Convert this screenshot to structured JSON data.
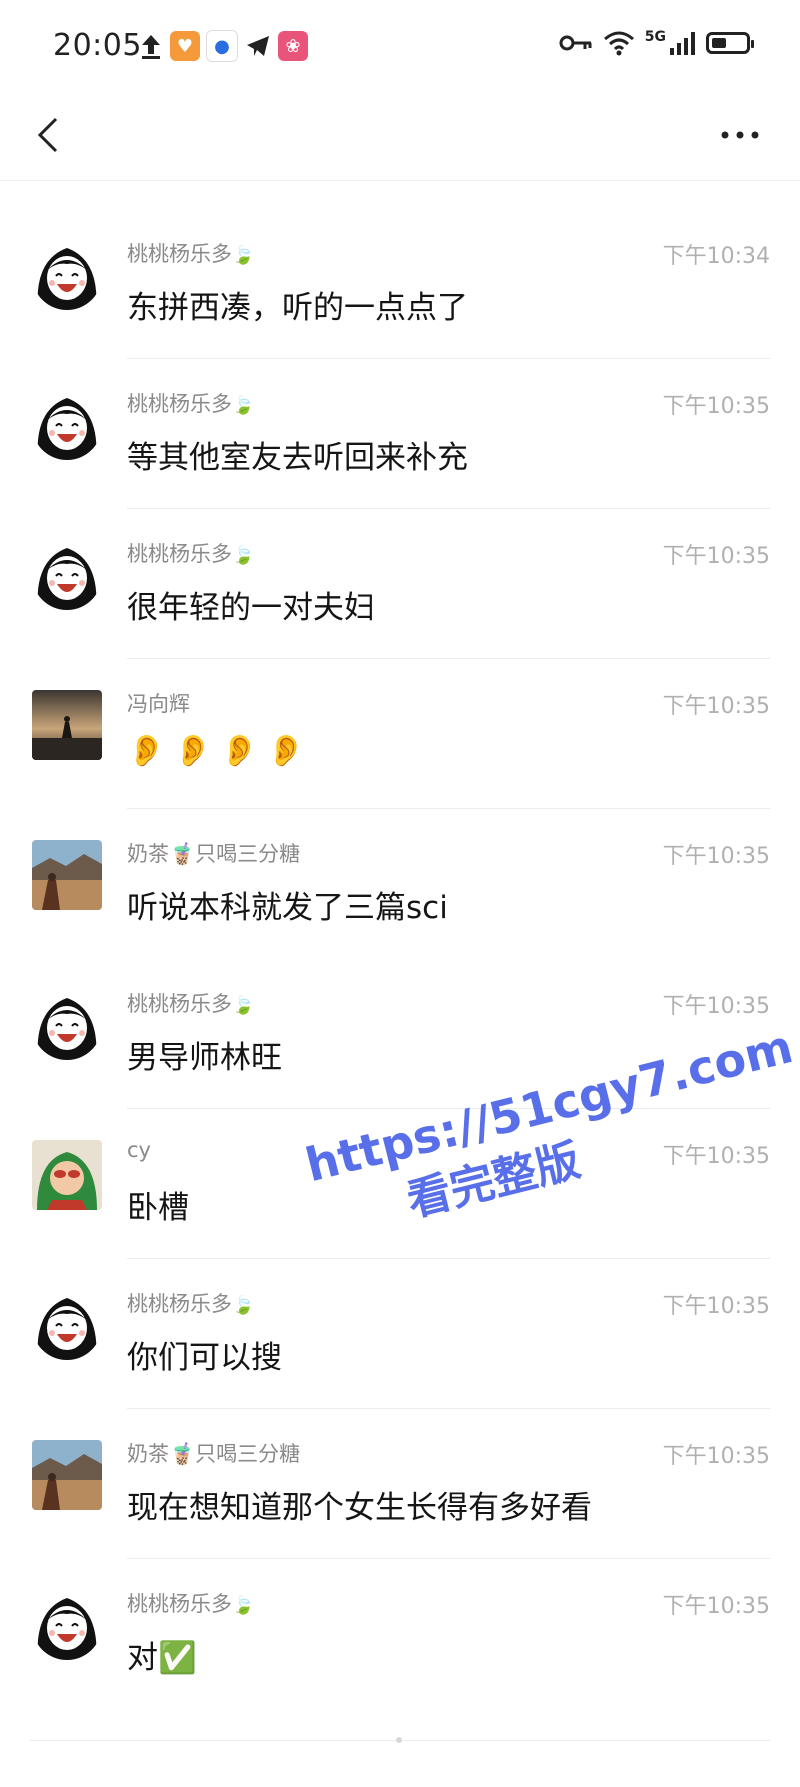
{
  "status_bar": {
    "time": "20:05",
    "network": "5G",
    "icons": [
      "upload-icon",
      "app-icon-orange",
      "app-icon-blue",
      "telegram-icon",
      "app-icon-pink",
      "key-icon",
      "wifi-icon",
      "signal-icon",
      "battery-icon"
    ]
  },
  "nav": {
    "back_icon": "chevron-left-icon",
    "more_icon": "more-horizontal-icon"
  },
  "messages": [
    {
      "sender": "桃桃杨乐多",
      "sender_emoji": "🍃",
      "time": "下午10:34",
      "text": "东拼西凑，听的一点点了",
      "avatar": "girl-cartoon"
    },
    {
      "sender": "桃桃杨乐多",
      "sender_emoji": "🍃",
      "time": "下午10:35",
      "text": "等其他室友去听回来补充",
      "avatar": "girl-cartoon"
    },
    {
      "sender": "桃桃杨乐多",
      "sender_emoji": "🍃",
      "time": "下午10:35",
      "text": "很年轻的一对夫妇",
      "avatar": "girl-cartoon"
    },
    {
      "sender": "冯向辉",
      "sender_emoji": "",
      "time": "下午10:35",
      "text": "👂👂👂👂",
      "avatar": "sunset-photo"
    },
    {
      "sender": "奶茶",
      "sender_emoji": "🧋只喝三分糖",
      "time": "下午10:35",
      "text": "听说本科就发了三篇sci",
      "avatar": "landscape-photo"
    },
    {
      "sender": "桃桃杨乐多",
      "sender_emoji": "🍃",
      "time": "下午10:35",
      "text": "男导师林旺",
      "avatar": "girl-cartoon"
    },
    {
      "sender": "cy",
      "sender_emoji": "",
      "time": "下午10:35",
      "text": "卧槽",
      "avatar": "kid-photo"
    },
    {
      "sender": "桃桃杨乐多",
      "sender_emoji": "🍃",
      "time": "下午10:35",
      "text": "你们可以搜",
      "avatar": "girl-cartoon"
    },
    {
      "sender": "奶茶",
      "sender_emoji": "🧋只喝三分糖",
      "time": "下午10:35",
      "text": "现在想知道那个女生长得有多好看",
      "avatar": "landscape-photo"
    },
    {
      "sender": "桃桃杨乐多",
      "sender_emoji": "🍃",
      "time": "下午10:35",
      "text": "对✅",
      "avatar": "girl-cartoon"
    }
  ],
  "watermark": {
    "url": "https://51cgy7.com",
    "subtitle": "看完整版"
  },
  "colors": {
    "watermark": "#4a63e8",
    "meta_text": "#8a8a8a",
    "time_text": "#b0b0b0"
  }
}
